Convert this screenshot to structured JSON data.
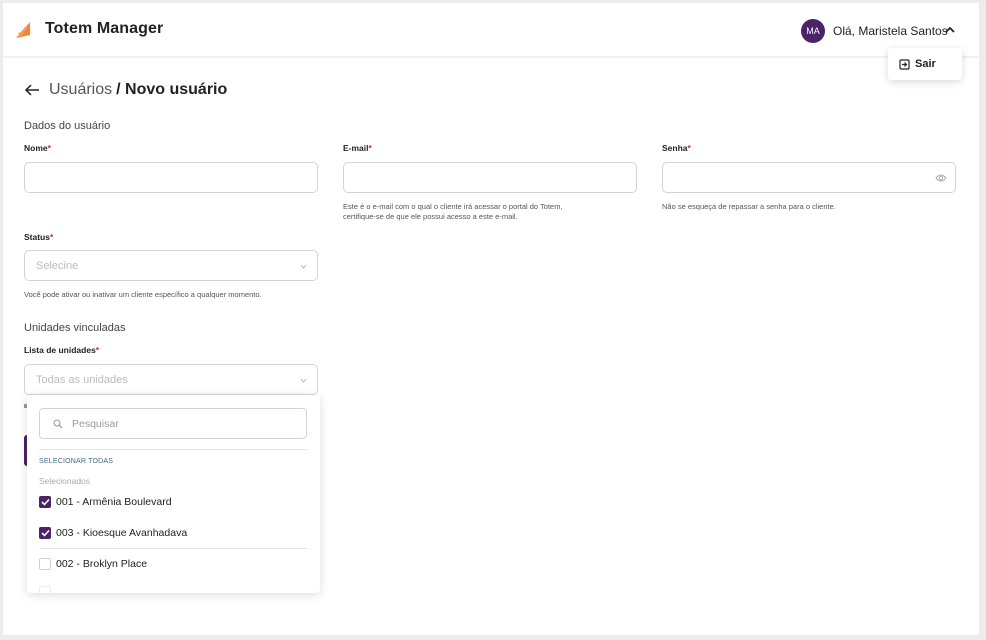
{
  "header": {
    "app_title": "Totem Manager",
    "avatar_initials": "MA",
    "greeting": "Olá, Maristela Santos",
    "logout_label": "Sair"
  },
  "breadcrumb": {
    "parent": "Usuários",
    "current": "/ Novo usuário"
  },
  "user_data": {
    "section_title": "Dados do usuário",
    "name": {
      "label": "Nome",
      "value": ""
    },
    "email": {
      "label": "E-mail",
      "value": "",
      "hint_line1": "Este é o e-mail com o qual o cliente irá acessar o portal do Totem,",
      "hint_line2": "certifique-se de que ele possui acesso a este e-mail."
    },
    "password": {
      "label": "Senha",
      "value": "",
      "hint": "Não se esqueça de repassar a senha para o cliente."
    },
    "status": {
      "label": "Status",
      "placeholder": "Selecine",
      "hint": "Você pode ativar ou inativar um cliente específico a qualquer momento."
    }
  },
  "units": {
    "section_title": "Unidades vinculadas",
    "list_label": "Lista de unidades",
    "placeholder": "Todas as unidades",
    "dropdown": {
      "search_placeholder": "Pesquisar",
      "select_all": "SELECIONAR TODAS",
      "selected_label": "Selecionados",
      "selected_items": [
        {
          "label": "001 - Armênia Boulevard",
          "checked": true
        },
        {
          "label": "003 - Kioesque Avanhadava",
          "checked": true
        }
      ],
      "other_items": [
        {
          "label": "002 - Broklyn Place",
          "checked": false
        }
      ]
    }
  },
  "colors": {
    "brand_purple": "#4a2466",
    "required_red": "#c0282e",
    "logo_orange": "#f07a1a",
    "logo_red": "#d8322b"
  }
}
